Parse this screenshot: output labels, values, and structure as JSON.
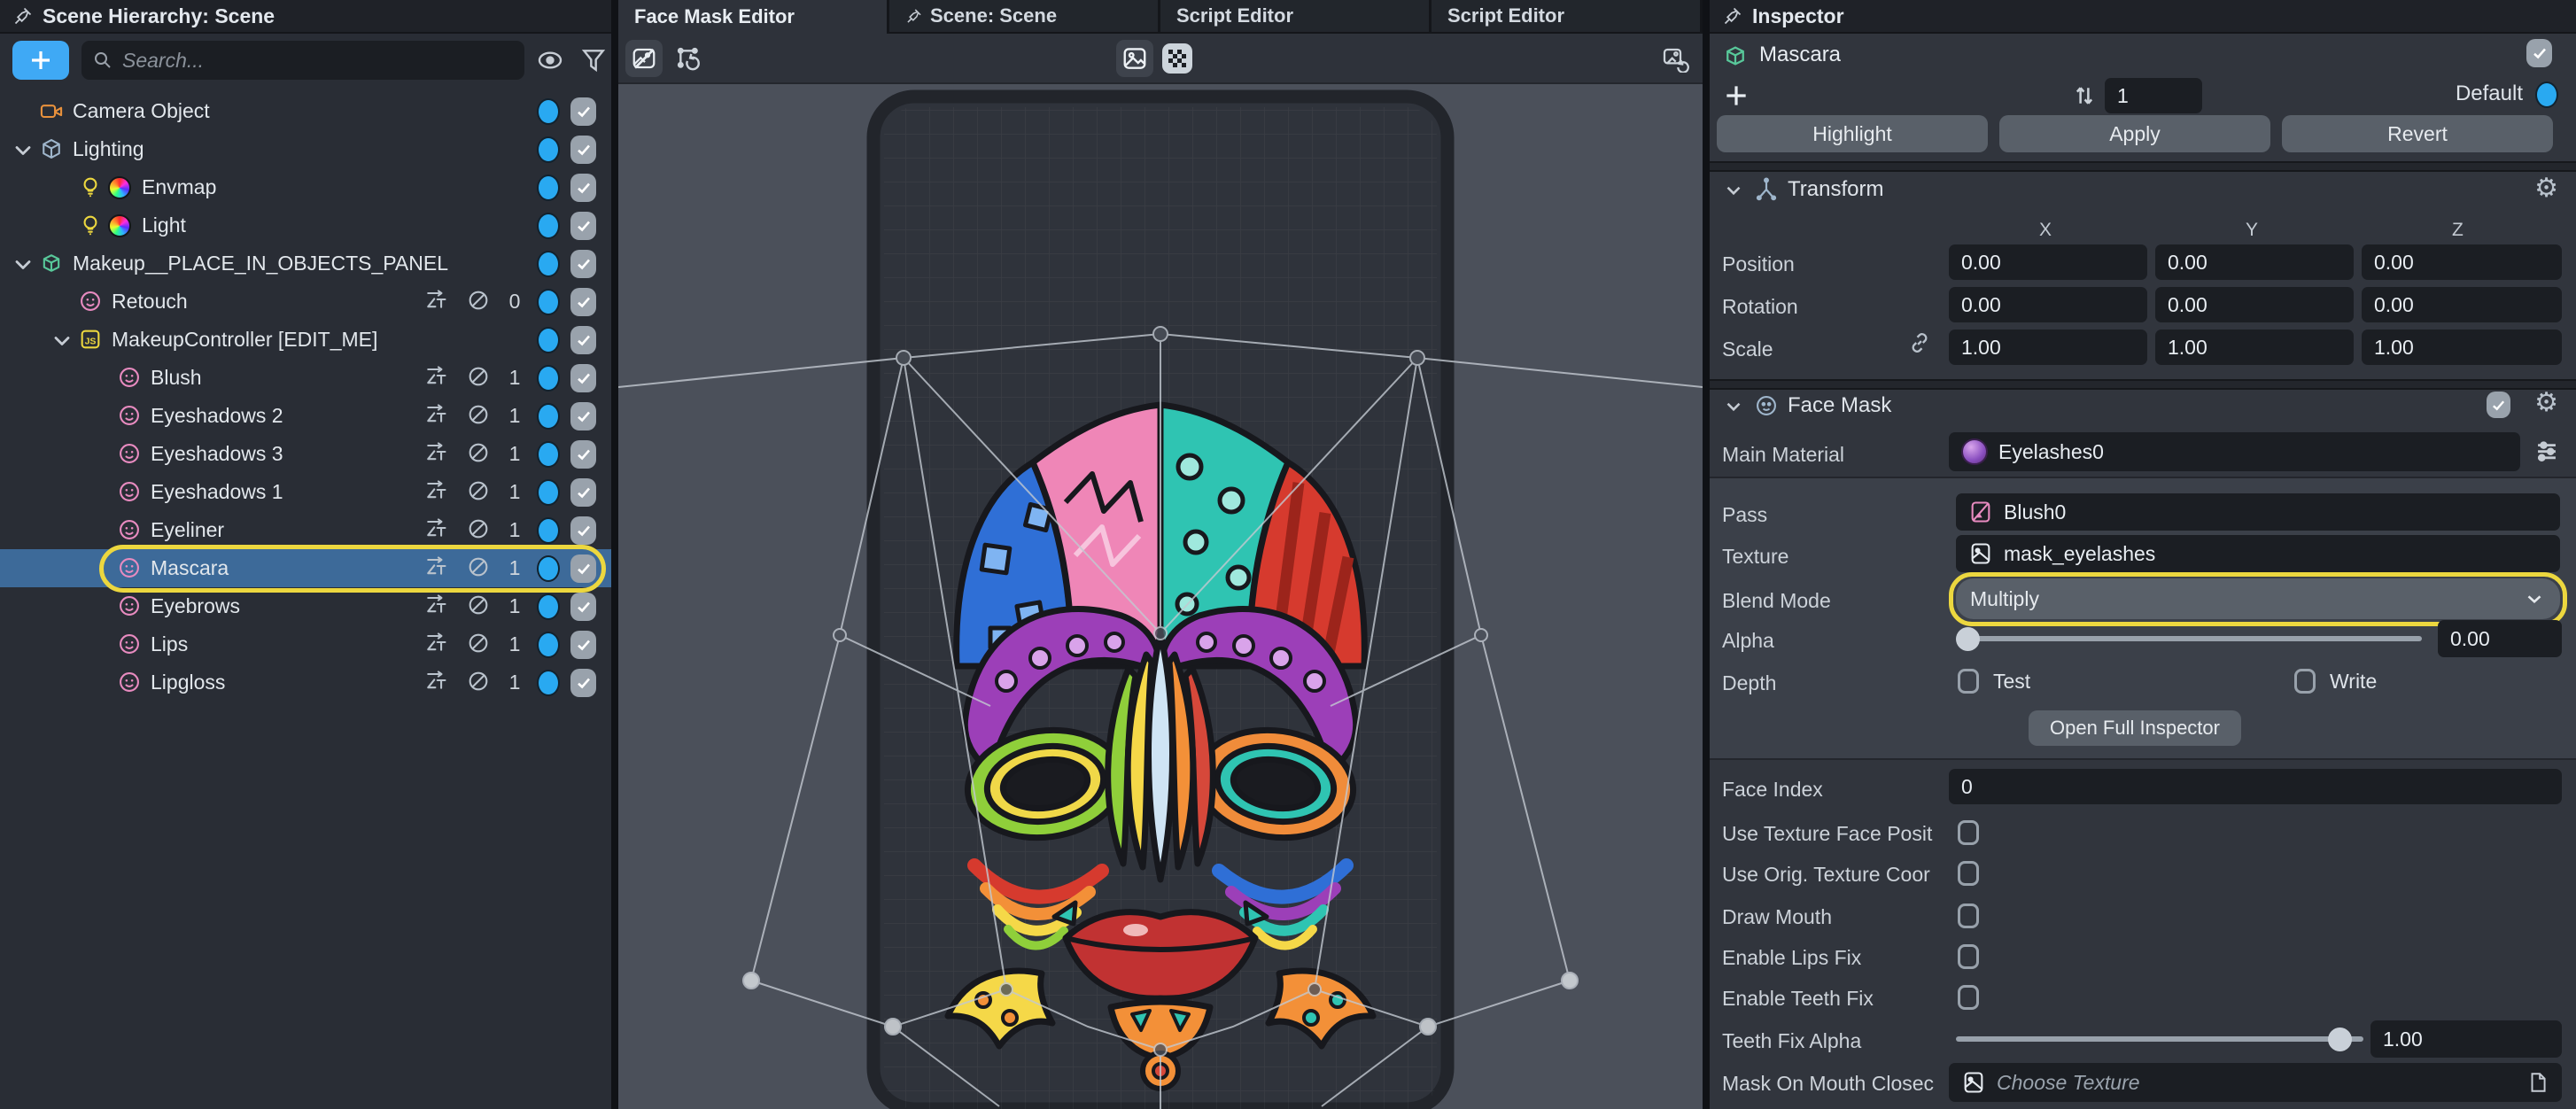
{
  "colors": {
    "accent_blue": "#3fa9f5",
    "selection_blue": "#3d6a99",
    "highlight_yellow": "#ecd73f",
    "toggle_blue_dot": "#29a9f1",
    "panel_dark": "#292d35",
    "panel_inspector": "#31353d"
  },
  "scene_hierarchy": {
    "title": "Scene Hierarchy: Scene",
    "search_placeholder": "Search...",
    "items": [
      {
        "label": "Camera Object",
        "icon": "camera",
        "depth": 0,
        "dot": true,
        "checked": true
      },
      {
        "label": "Lighting",
        "icon": "box",
        "depth": 0,
        "expanded": true,
        "dot": true,
        "checked": true
      },
      {
        "label": "Envmap",
        "icon": "light",
        "colorwheel": true,
        "depth": 1,
        "dot": true,
        "checked": true
      },
      {
        "label": "Light",
        "icon": "light",
        "colorwheel": true,
        "depth": 1,
        "dot": true,
        "checked": true
      },
      {
        "label": "Makeup__PLACE_IN_OBJECTS_PANEL",
        "icon": "prefab",
        "depth": 0,
        "expanded": true,
        "dot": true,
        "checked": true
      },
      {
        "label": "Retouch",
        "icon": "face",
        "depth": 1,
        "zt": true,
        "occ": true,
        "count": "0",
        "dot": true,
        "checked": true
      },
      {
        "label": "MakeupController [EDIT_ME]",
        "icon": "js",
        "depth": 1,
        "expanded": true,
        "dot": true,
        "checked": true
      },
      {
        "label": "Blush",
        "icon": "face",
        "depth": 2,
        "zt": true,
        "occ": true,
        "count": "1",
        "dot": true,
        "checked": true
      },
      {
        "label": "Eyeshadows 2",
        "icon": "face",
        "depth": 2,
        "zt": true,
        "occ": true,
        "count": "1",
        "dot": true,
        "checked": true
      },
      {
        "label": "Eyeshadows 3",
        "icon": "face",
        "depth": 2,
        "zt": true,
        "occ": true,
        "count": "1",
        "dot": true,
        "checked": true
      },
      {
        "label": "Eyeshadows 1",
        "icon": "face",
        "depth": 2,
        "zt": true,
        "occ": true,
        "count": "1",
        "dot": true,
        "checked": true
      },
      {
        "label": "Eyeliner",
        "icon": "face",
        "depth": 2,
        "zt": true,
        "occ": true,
        "count": "1",
        "dot": true,
        "checked": true
      },
      {
        "label": "Mascara",
        "icon": "face",
        "depth": 2,
        "zt": true,
        "occ": true,
        "count": "1",
        "dot": true,
        "checked": true,
        "selected": true
      },
      {
        "label": "Eyebrows",
        "icon": "face",
        "depth": 2,
        "zt": true,
        "occ": true,
        "count": "1",
        "dot": true,
        "checked": true
      },
      {
        "label": "Lips",
        "icon": "face",
        "depth": 2,
        "zt": true,
        "occ": true,
        "count": "1",
        "dot": true,
        "checked": true
      },
      {
        "label": "Lipgloss",
        "icon": "face",
        "depth": 2,
        "zt": true,
        "occ": true,
        "count": "1",
        "dot": true,
        "checked": true
      }
    ]
  },
  "tabs": [
    {
      "label": "Face Mask Editor",
      "active": true,
      "pin": false
    },
    {
      "label": "Scene: Scene",
      "active": false,
      "pin": true
    },
    {
      "label": "Script Editor",
      "active": false,
      "pin": false
    },
    {
      "label": "Script Editor",
      "active": false,
      "pin": false
    }
  ],
  "inspector": {
    "title": "Inspector",
    "object_name": "Mascara",
    "instance_value": "1",
    "default_label": "Default",
    "buttons": {
      "highlight": "Highlight",
      "apply": "Apply",
      "revert": "Revert"
    },
    "transform": {
      "title": "Transform",
      "axis_labels": [
        "X",
        "Y",
        "Z"
      ],
      "rows": [
        {
          "label": "Position",
          "x": "0.00",
          "y": "0.00",
          "z": "0.00"
        },
        {
          "label": "Rotation",
          "x": "0.00",
          "y": "0.00",
          "z": "0.00"
        },
        {
          "label": "Scale",
          "linked": true,
          "x": "1.00",
          "y": "1.00",
          "z": "1.00"
        }
      ]
    },
    "face_mask": {
      "title": "Face Mask",
      "main_material": {
        "label": "Main Material",
        "value": "Eyelashes0"
      },
      "pass": {
        "label": "Pass",
        "value": "Blush0"
      },
      "texture": {
        "label": "Texture",
        "value": "mask_eyelashes"
      },
      "blend_mode": {
        "label": "Blend Mode",
        "value": "Multiply"
      },
      "alpha": {
        "label": "Alpha",
        "value": "0.00",
        "slider_pos": 0
      },
      "depth": {
        "label": "Depth",
        "test_label": "Test",
        "write_label": "Write"
      },
      "open_full_inspector": "Open Full Inspector",
      "face_index": {
        "label": "Face Index",
        "value": "0"
      },
      "toggles": [
        {
          "label": "Use Texture Face Posit"
        },
        {
          "label": "Use Orig. Texture Coor"
        },
        {
          "label": "Draw Mouth"
        },
        {
          "label": "Enable Lips Fix"
        },
        {
          "label": "Enable Teeth Fix"
        }
      ],
      "teeth_fix_alpha": {
        "label": "Teeth Fix Alpha",
        "value": "1.00",
        "slider_pos": 0.93
      },
      "mask_on_mouth_closed": {
        "label": "Mask On Mouth Closec",
        "placeholder": "Choose Texture"
      }
    }
  }
}
